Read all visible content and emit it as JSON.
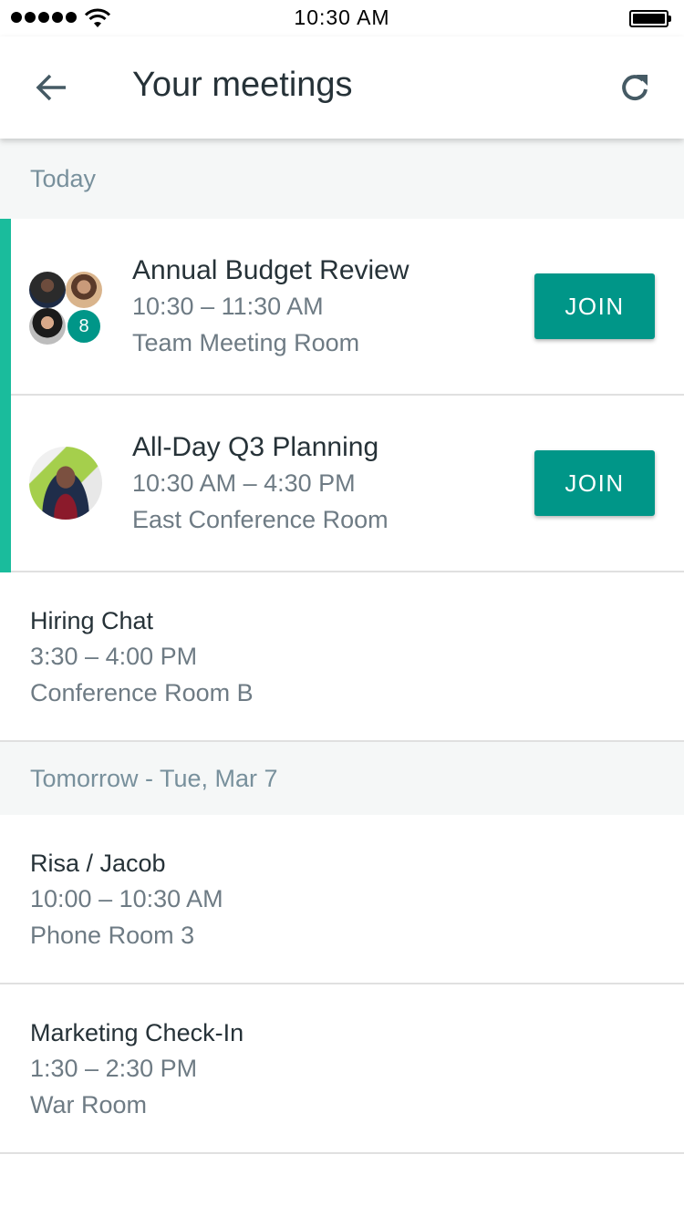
{
  "status_bar": {
    "time": "10:30 AM",
    "signal_bars": 5,
    "battery_level": 1.0
  },
  "app_bar": {
    "title": "Your meetings",
    "back_icon": "arrow-left-icon",
    "refresh_icon": "refresh-icon"
  },
  "colors": {
    "accent": "#1abc9c",
    "join_button": "#009688",
    "section_text": "#78909c",
    "section_bg": "#f5f7f7"
  },
  "sections": [
    {
      "header": "Today",
      "meetings": [
        {
          "title": "Annual Budget Review",
          "time": "10:30 – 11:30 AM",
          "room": "Team Meeting Room",
          "join_label": "JOIN",
          "extra_attendees": "8",
          "active": true
        },
        {
          "title": "All-Day Q3 Planning",
          "time": "10:30 AM – 4:30 PM",
          "room": "East Conference Room",
          "join_label": "JOIN",
          "active": true
        },
        {
          "title": "Hiring Chat",
          "time": "3:30 – 4:00 PM",
          "room": "Conference Room B",
          "active": false
        }
      ]
    },
    {
      "header": "Tomorrow - Tue, Mar 7",
      "meetings": [
        {
          "title": "Risa / Jacob",
          "time": "10:00 – 10:30 AM",
          "room": "Phone Room 3",
          "active": false
        },
        {
          "title": "Marketing Check-In",
          "time": "1:30 – 2:30 PM",
          "room": "War Room",
          "active": false
        }
      ]
    }
  ]
}
